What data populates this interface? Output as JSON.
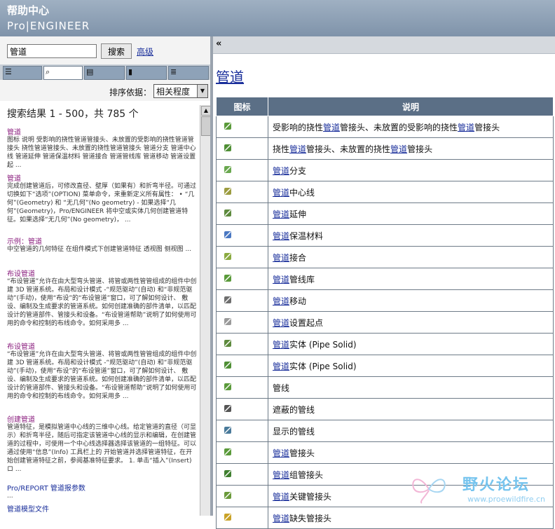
{
  "header": {
    "title_cn": "帮助中心",
    "title_en": "Pro|ENGINEER"
  },
  "search": {
    "value": "管道",
    "button": "搜索",
    "advanced": "高级"
  },
  "sort": {
    "label": "排序依据：",
    "selected": "相关程度"
  },
  "results": {
    "heading": "搜索结果 1 - 500，共 785 个",
    "items": [
      {
        "title": "管道",
        "body": "图标 说明 受影响的挠性管道管接头、未放置的受影响的挠性管道管接头 挠性管道管接头、未放置的挠性管道管接头 管道分支 管道中心线 管道延伸 管道保温材料 管道接合 管道管线库 管道移动 管道设置起 ..."
      },
      {
        "title": "管道",
        "body": "完成创建管道后，可修改直径、壁厚（如果有）和折弯半径。可通过切换如下“选项”(OPTION) 菜单命令，来重新定义所有属性：  • “几何”(Geometry) 和 “无几何”(No geometry) - 如果选择“几何”(Geometry)，Pro/ENGINEER 将中空或实体几何创建管道特征。如果选择“无几何”(No geometry)， ..."
      },
      {
        "title": "示例：管道",
        "body": "中空管道的几何特征 在组件模式下创建管道特征 透视图 侧视图 ..."
      },
      {
        "title": "布设管道",
        "body": "“布设管道”允许在由大型弯头管道、将管或两性管管组成的组件中创建 3D 管道系统。布局和设计模式 -“规范驱动”(自动) 和“非规范驱动”(手动)，使用“布设”的“布设管道”窗口，可了解如何设计、 敷设、编制及生成要求的管道系统。如何创建准确的部件清单，以匹配设计的管道部件、管接头和设备。“布设管道帮助”说明了如何使用可用的命令和控制的布线命令。如何采用多 ..."
      },
      {
        "title": "布设管道",
        "body": "“布设管道”允许在由大型弯头管道、将管或两性管管组成的组件中创建 3D 管道系统。布局和设计模式 -“规范驱动”(自动) 和“非规范驱动”(手动)，使用“布设”的“布设管道”窗口，可了解如何设计、 敷设、编制及生成要求的管道系统。如何创建准确的部件清单，以匹配设计的管道部件、管接头和设备。“布设管道帮助”说明了如何使用可用的命令和控制的布线命令。如何采用多 ..."
      },
      {
        "title": "创建管道",
        "body": "管道特征，是模拟管道中心线的三维中心线。给定管道的直径（可显示）和折弯半径，随后可指定该管道中心线的显示和编辑，在创建管道的过程中，可使用一个中心线选择器选择该管道的一组特征。可以通过使用“信息”(Info) 工具栏上的 开始管道并选择管道特征，在开始创建管道特征之前，参阅基准特征要求。 1. 单击“插入”(Insert) ロ ..."
      }
    ],
    "footer_link": "Pro/REPORT 管道报参数",
    "footer_dots": "...",
    "footer_last": "管道模型文件"
  },
  "right": {
    "collapse_label": "«",
    "page_title": "管道",
    "table": {
      "headers": [
        "图标",
        "说明"
      ],
      "rows": [
        {
          "icon": "flex-pipe-fitting-affected-icon",
          "color": "#5a9a3a",
          "pre": "受影响的挠性",
          "kw": "管道",
          "post": "管接头、未放置的受影响的挠性",
          "kw2": "管道",
          "post2": "管接头"
        },
        {
          "icon": "flex-pipe-fitting-icon",
          "color": "#4f8f35",
          "pre": "挠性",
          "kw": "管道",
          "post": "管接头、未放置的挠性",
          "kw2": "管道",
          "post2": "管接头"
        },
        {
          "icon": "pipe-branch-icon",
          "color": "#6aa84f",
          "pre": "",
          "kw": "管道",
          "post": "分支",
          "kw2": "",
          "post2": ""
        },
        {
          "icon": "pipe-centerline-icon",
          "color": "#9c9c40",
          "pre": "",
          "kw": "管道",
          "post": "中心线",
          "kw2": "",
          "post2": ""
        },
        {
          "icon": "pipe-extend-icon",
          "color": "#5d8a3d",
          "pre": "",
          "kw": "管道",
          "post": "延伸",
          "kw2": "",
          "post2": ""
        },
        {
          "icon": "pipe-insulation-icon",
          "color": "#4a78c2",
          "pre": "",
          "kw": "管道",
          "post": "保温材料",
          "kw2": "",
          "post2": ""
        },
        {
          "icon": "pipe-joint-icon",
          "color": "#8aaa40",
          "pre": "",
          "kw": "管道",
          "post": "接合",
          "kw2": "",
          "post2": ""
        },
        {
          "icon": "pipe-line-library-icon",
          "color": "#5a9a3a",
          "pre": "",
          "kw": "管道",
          "post": "管线库",
          "kw2": "",
          "post2": ""
        },
        {
          "icon": "pipe-move-icon",
          "color": "#6f6f6f",
          "pre": "",
          "kw": "管道",
          "post": "移动",
          "kw2": "",
          "post2": ""
        },
        {
          "icon": "pipe-set-start-icon",
          "color": "#9a9a9a",
          "pre": "",
          "kw": "管道",
          "post": "设置起点",
          "kw2": "",
          "post2": ""
        },
        {
          "icon": "pipe-solid-icon",
          "color": "#5d8a3d",
          "pre": "",
          "kw": "管道",
          "post": "实体 (Pipe Solid)",
          "kw2": "",
          "post2": ""
        },
        {
          "icon": "pipe-solid-alt-icon",
          "color": "#4f8f35",
          "pre": "",
          "kw": "管道",
          "post": "实体 (Pipe Solid)",
          "kw2": "",
          "post2": ""
        },
        {
          "icon": "pipeline-icon",
          "color": "#5a9a3a",
          "pre": "管线",
          "kw": "",
          "post": "",
          "kw2": "",
          "post2": ""
        },
        {
          "icon": "hidden-pipeline-icon",
          "color": "#555555",
          "pre": "遮蔽的管线",
          "kw": "",
          "post": "",
          "kw2": "",
          "post2": ""
        },
        {
          "icon": "visible-pipeline-icon",
          "color": "#4a7a9a",
          "pre": "显示的管线",
          "kw": "",
          "post": "",
          "kw2": "",
          "post2": ""
        },
        {
          "icon": "pipe-fitting-icon",
          "color": "#5a9a3a",
          "pre": "",
          "kw": "管道",
          "post": "管接头",
          "kw2": "",
          "post2": ""
        },
        {
          "icon": "pipe-group-fitting-icon",
          "color": "#3f7f2f",
          "pre": "",
          "kw": "管道",
          "post": "组管接头",
          "kw2": "",
          "post2": ""
        },
        {
          "icon": "pipe-key-fitting-icon",
          "color": "#6a9a3a",
          "pre": "",
          "kw": "管道",
          "post": "关键管接头",
          "kw2": "",
          "post2": ""
        },
        {
          "icon": "pipe-missing-fitting-icon",
          "color": "#c9a227",
          "pre": "",
          "kw": "管道",
          "post": "缺失管接头",
          "kw2": "",
          "post2": ""
        }
      ]
    }
  },
  "watermark": {
    "text": "野火论坛",
    "url": "www.proewildfire.cn"
  },
  "colors": {
    "header": "#8a9bb0",
    "table_header": "#5b6f86",
    "link": "#1a2f9b",
    "result_title": "#8b1f7f"
  }
}
